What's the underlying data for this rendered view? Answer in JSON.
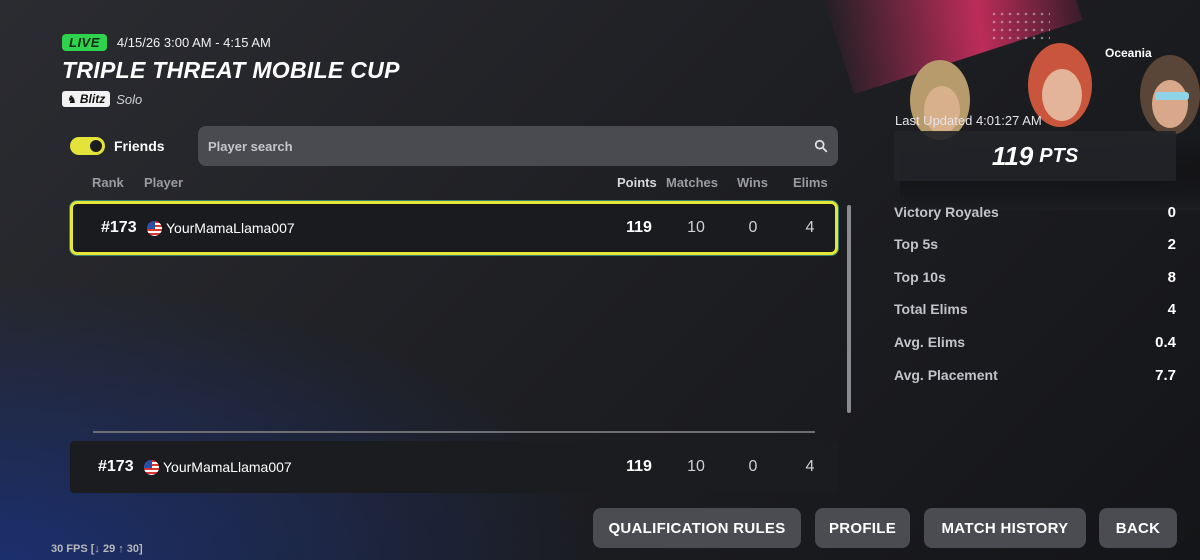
{
  "event": {
    "live_label": "LIVE",
    "time_range": "4/15/26 3:00 AM - 4:15 AM",
    "title": "TRIPLE THREAT MOBILE CUP",
    "mode_badge": "Blitz",
    "mode_type": "Solo"
  },
  "filters": {
    "friends_label": "Friends",
    "friends_on": true,
    "search_placeholder": "Player search"
  },
  "table": {
    "headers": {
      "rank": "Rank",
      "player": "Player",
      "points": "Points",
      "matches": "Matches",
      "wins": "Wins",
      "elims": "Elims"
    },
    "rows": [
      {
        "rank": "#173",
        "player": "YourMamaLlama007",
        "points": "119",
        "matches": "10",
        "wins": "0",
        "elims": "4"
      }
    ],
    "pinned": {
      "rank": "#173",
      "player": "YourMamaLlama007",
      "points": "119",
      "matches": "10",
      "wins": "0",
      "elims": "4"
    }
  },
  "panel": {
    "region": "Oceania",
    "last_updated": "Last Updated 4:01:27 AM",
    "points_value": "119",
    "points_unit": "PTS",
    "stats": [
      {
        "label": "Victory Royales",
        "value": "0"
      },
      {
        "label": "Top 5s",
        "value": "2"
      },
      {
        "label": "Top 10s",
        "value": "8"
      },
      {
        "label": "Total Elims",
        "value": "4"
      },
      {
        "label": "Avg. Elims",
        "value": "0.4"
      },
      {
        "label": "Avg. Placement",
        "value": "7.7"
      }
    ]
  },
  "buttons": {
    "qualification_rules": "QUALIFICATION RULES",
    "profile": "PROFILE",
    "match_history": "MATCH HISTORY",
    "back": "BACK"
  },
  "fps": "30 FPS [↓ 29 ↑ 30]",
  "colors": {
    "live": "#2fd34e",
    "highlight": "#e6e636",
    "button": "#4b4c51"
  }
}
